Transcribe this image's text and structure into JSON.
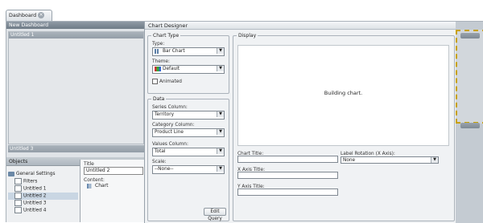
{
  "tab": {
    "label": "Dashboard"
  },
  "left": {
    "new_dashboard": "New Dashboard",
    "panel1_title": "Untitled 1",
    "panel3_title": "Untitled 3",
    "objects_header": "Objects",
    "tree": [
      {
        "label": "General Settings"
      },
      {
        "label": "Filters"
      },
      {
        "label": "Untitled 1"
      },
      {
        "label": "Untitled 2"
      },
      {
        "label": "Untitled 3"
      },
      {
        "label": "Untitled 4"
      }
    ],
    "props": {
      "title_label": "Title",
      "title_value": "Untitled 2",
      "content_label": "Content:",
      "content_value": "Chart"
    }
  },
  "designer": {
    "header": "Chart Designer",
    "chart_type": {
      "legend": "Chart Type",
      "type_label": "Type:",
      "type_value": "Bar Chart",
      "theme_label": "Theme:",
      "theme_value": "Default",
      "animated_label": "Animated"
    },
    "data": {
      "legend": "Data",
      "series_label": "Series Column:",
      "series_value": "Territory",
      "category_label": "Category Column:",
      "category_value": "Product Line",
      "values_label": "Values Column:",
      "values_value": "Total",
      "scale_label": "Scale:",
      "scale_value": "--None--",
      "edit_query": "Edit Query"
    },
    "display": {
      "legend": "Display",
      "preview_text": "Building chart.",
      "chart_title_label": "Chart Title:",
      "x_axis_label": "X Axis Title:",
      "y_axis_label": "Y Axis Title:",
      "label_rotation_label": "Label Rotation (X Axis):",
      "label_rotation_value": "None"
    }
  },
  "colors": {
    "accent": "#c8a100",
    "header": "#7d8892"
  }
}
